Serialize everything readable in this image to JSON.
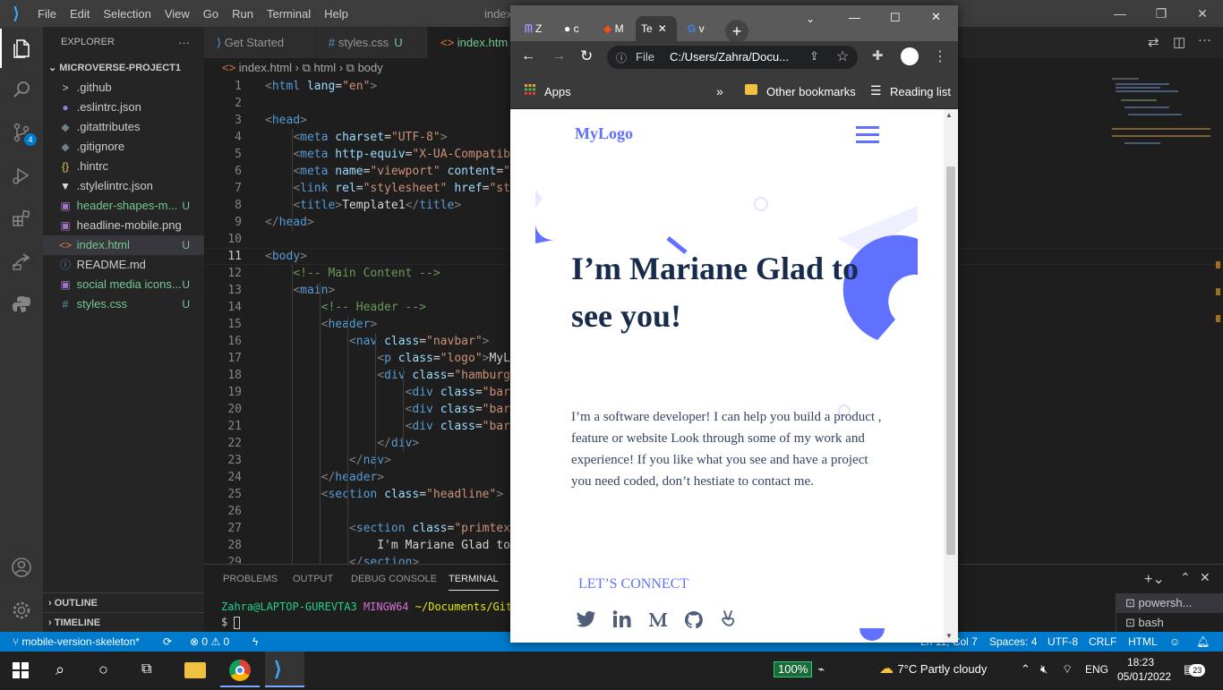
{
  "titlebar": {
    "menus": [
      "File",
      "Edit",
      "Selection",
      "View",
      "Go",
      "Run",
      "Terminal",
      "Help"
    ],
    "title_fragment": "index"
  },
  "activity": {
    "scm_badge": "4"
  },
  "explorer": {
    "header": "EXPLORER",
    "more": "···",
    "root": "MICROVERSE-PROJECT1",
    "files": [
      {
        "name": ".github",
        "icon": ">",
        "status": ""
      },
      {
        "name": ".eslintrc.json",
        "icon": "●",
        "status": ""
      },
      {
        "name": ".gitattributes",
        "icon": "◆",
        "status": ""
      },
      {
        "name": ".gitignore",
        "icon": "◆",
        "status": ""
      },
      {
        "name": ".hintrc",
        "icon": "{}",
        "status": ""
      },
      {
        "name": ".stylelintrc.json",
        "icon": "▼",
        "status": ""
      },
      {
        "name": "header-shapes-m...",
        "icon": "▣",
        "status": "U"
      },
      {
        "name": "headline-mobile.png",
        "icon": "▣",
        "status": ""
      },
      {
        "name": "index.html",
        "icon": "<>",
        "status": "U"
      },
      {
        "name": "README.md",
        "icon": "ⓘ",
        "status": ""
      },
      {
        "name": "social media icons...",
        "icon": "▣",
        "status": "U"
      },
      {
        "name": "styles.css",
        "icon": "#",
        "status": "U"
      }
    ],
    "outline": "OUTLINE",
    "timeline": "TIMELINE"
  },
  "tabs": [
    {
      "label": "Get Started",
      "status": ""
    },
    {
      "label": "styles.css",
      "status": "U"
    },
    {
      "label": "index.html",
      "status": ""
    }
  ],
  "breadcrumb": {
    "file": "index.html",
    "el1": "html",
    "el2": "body"
  },
  "code_lines": [
    {
      "n": "1",
      "code": "<html lang=\"en\">"
    },
    {
      "n": "2",
      "code": ""
    },
    {
      "n": "3",
      "code": "<head>"
    },
    {
      "n": "4",
      "code": "    <meta charset=\"UTF-8\">"
    },
    {
      "n": "5",
      "code": "    <meta http-equiv=\"X-UA-Compatibl"
    },
    {
      "n": "6",
      "code": "    <meta name=\"viewport\" content=\"w"
    },
    {
      "n": "7",
      "code": "    <link rel=\"stylesheet\" href=\"sty"
    },
    {
      "n": "8",
      "code": "    <title>Template1</title>"
    },
    {
      "n": "9",
      "code": "</head>"
    },
    {
      "n": "10",
      "code": ""
    },
    {
      "n": "11",
      "code": "<body>"
    },
    {
      "n": "12",
      "code": "    <!-- Main Content -->"
    },
    {
      "n": "13",
      "code": "    <main>"
    },
    {
      "n": "14",
      "code": "        <!-- Header -->"
    },
    {
      "n": "15",
      "code": "        <header>"
    },
    {
      "n": "16",
      "code": "            <nav class=\"navbar\">"
    },
    {
      "n": "17",
      "code": "                <p class=\"logo\">MyLo"
    },
    {
      "n": "18",
      "code": "                <div class=\"hamburge"
    },
    {
      "n": "19",
      "code": "                    <div class=\"bar\""
    },
    {
      "n": "20",
      "code": "                    <div class=\"bar\""
    },
    {
      "n": "21",
      "code": "                    <div class=\"bar\""
    },
    {
      "n": "22",
      "code": "                </div>"
    },
    {
      "n": "23",
      "code": "            </nav>"
    },
    {
      "n": "24",
      "code": "        </header>"
    },
    {
      "n": "25",
      "code": "        <section class=\"headline\">"
    },
    {
      "n": "26",
      "code": ""
    },
    {
      "n": "27",
      "code": "            <section class=\"primtext"
    },
    {
      "n": "28",
      "code": "                I'm Mariane Glad to"
    },
    {
      "n": "29",
      "code": "            </section>"
    }
  ],
  "panel": {
    "tabs": [
      "PROBLEMS",
      "OUTPUT",
      "DEBUG CONSOLE",
      "TERMINAL"
    ],
    "prompt_user": "Zahra@LAPTOP-GUREVTA3",
    "prompt_shell": "MINGW64",
    "prompt_path": "~/Documents/GitH",
    "prompt_symbol": "$",
    "terminals": [
      "powersh...",
      "bash"
    ]
  },
  "status": {
    "branch": "mobile-version-skeleton*",
    "errors": "0",
    "warnings": "0",
    "position": "Ln 11, Col 7",
    "spaces": "Spaces: 4",
    "encoding": "UTF-8",
    "eol": "CRLF",
    "language": "HTML"
  },
  "chrome": {
    "tabs": [
      "Z",
      "c",
      "M",
      "Te",
      "v"
    ],
    "url_scheme": "File",
    "url": "C:/Users/Zahra/Docu...",
    "bookmarks": {
      "apps": "Apps",
      "more": "»",
      "other": "Other bookmarks",
      "reading": "Reading list"
    }
  },
  "site": {
    "logo": "MyLogo",
    "headline": "I’m Mariane Glad to see you!",
    "intro": "I’m a software developer! I can help you build a product , feature or website Look through some of my work and experience! If you like what you see and have a project you need coded, don’t hestiate to contact me.",
    "connect": "LET’S CONNECT",
    "accent": "#6070ff",
    "dark": "#172b4d"
  },
  "taskbar": {
    "battery": "100%",
    "weather_temp": "7°C",
    "weather_desc": "Partly cloudy",
    "lang": "ENG",
    "time": "18:23",
    "date": "05/01/2022",
    "notifications": "23"
  }
}
